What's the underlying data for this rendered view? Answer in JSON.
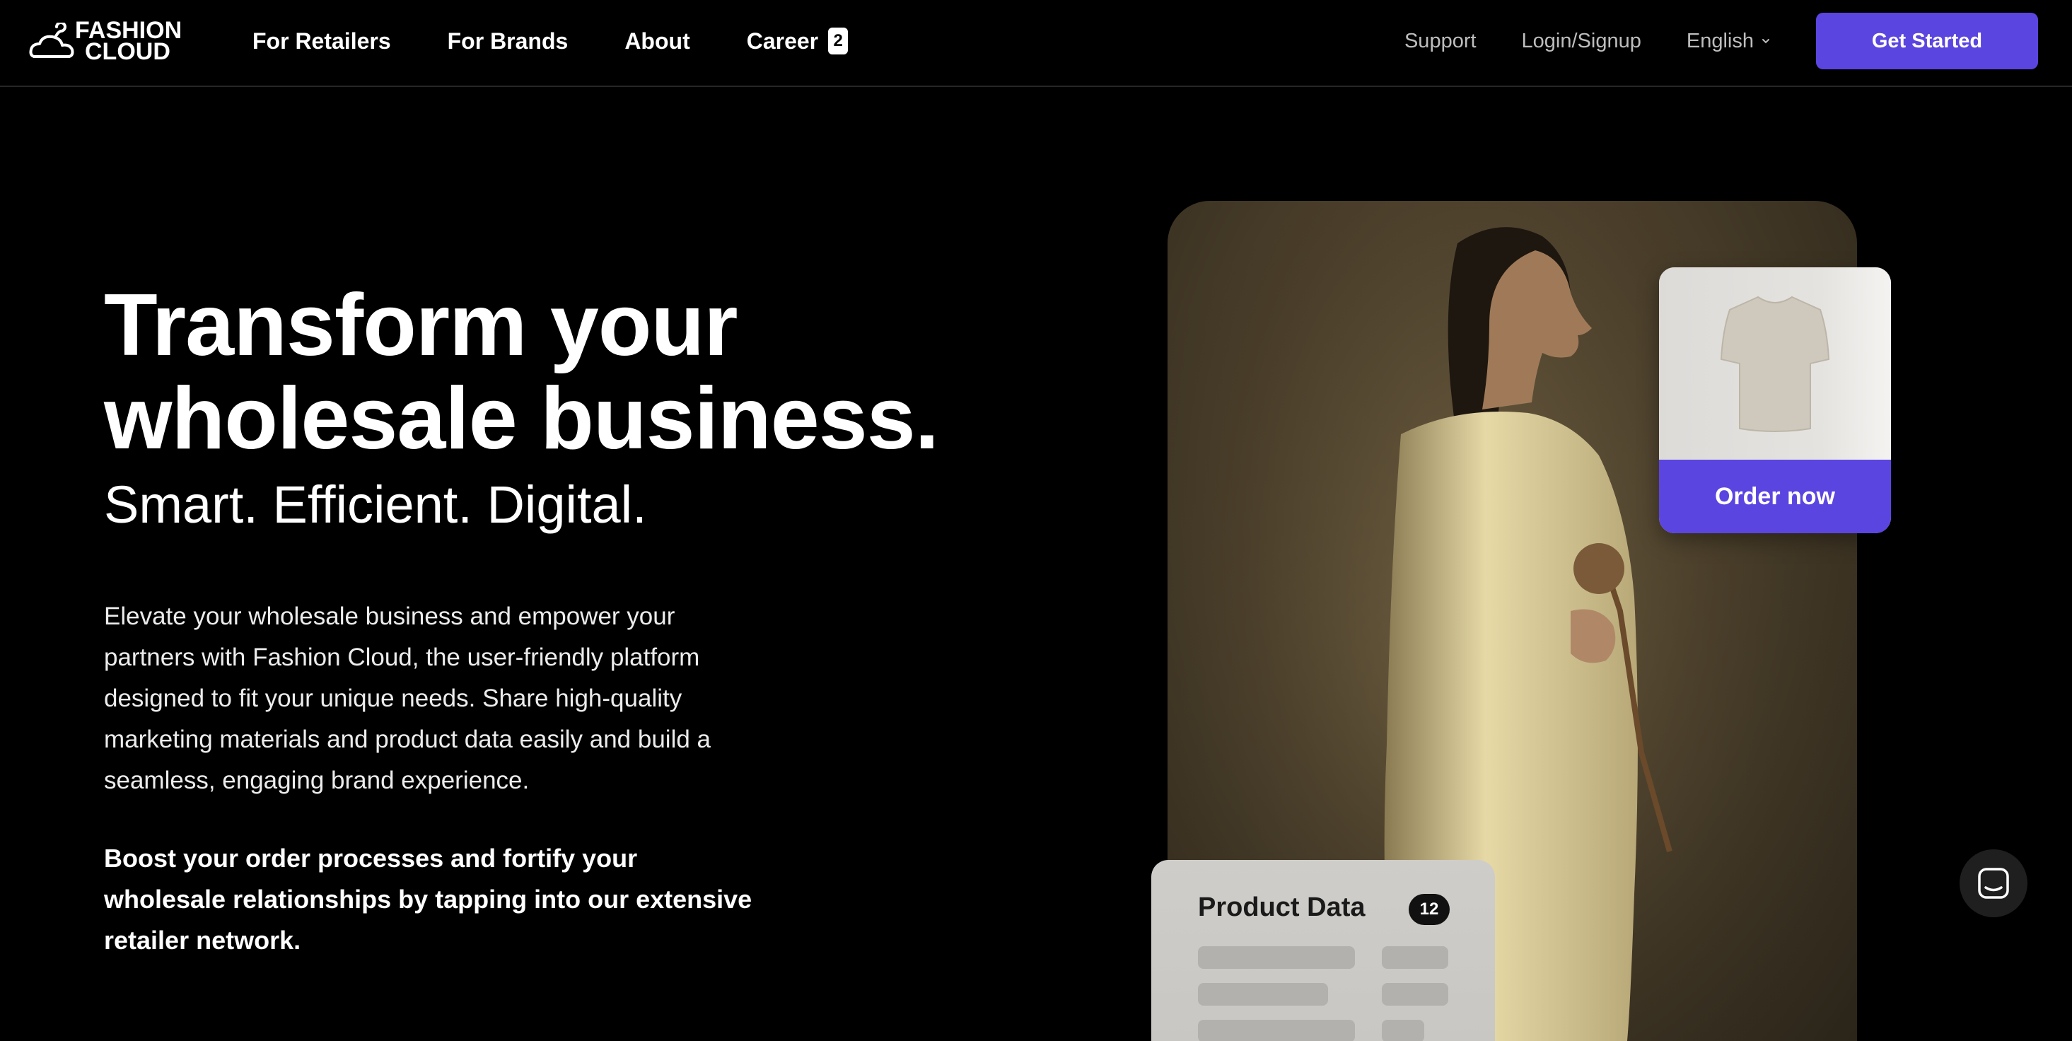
{
  "brand": {
    "logo_line1": "FASHION",
    "logo_line2": "CLOUD",
    "accent_color": "#5b45e0"
  },
  "nav": {
    "links": [
      {
        "label": "For Retailers"
      },
      {
        "label": "For Brands"
      },
      {
        "label": "About"
      },
      {
        "label": "Career",
        "badge": "2"
      }
    ],
    "support": "Support",
    "login": "Login/Signup",
    "language": "English",
    "cta": "Get Started"
  },
  "hero": {
    "title_line1": "Transform your",
    "title_line2": "wholesale business.",
    "subtitle": "Smart. Efficient. Digital.",
    "body": "Elevate your wholesale business and empower your partners with Fashion Cloud, the user-friendly platform designed to fit your unique needs. Share high-quality marketing materials and product data easily and build a seamless, engaging brand experience.",
    "bold": "Boost your order processes and fortify your wholesale relationships by tapping into our extensive retailer network."
  },
  "cards": {
    "order_label": "Order now",
    "product_data_title": "Product Data",
    "product_data_count": "12"
  },
  "icons": {
    "logo": "hanger-cloud-icon",
    "chevron": "chevron-down-icon",
    "chat": "chat-icon"
  }
}
